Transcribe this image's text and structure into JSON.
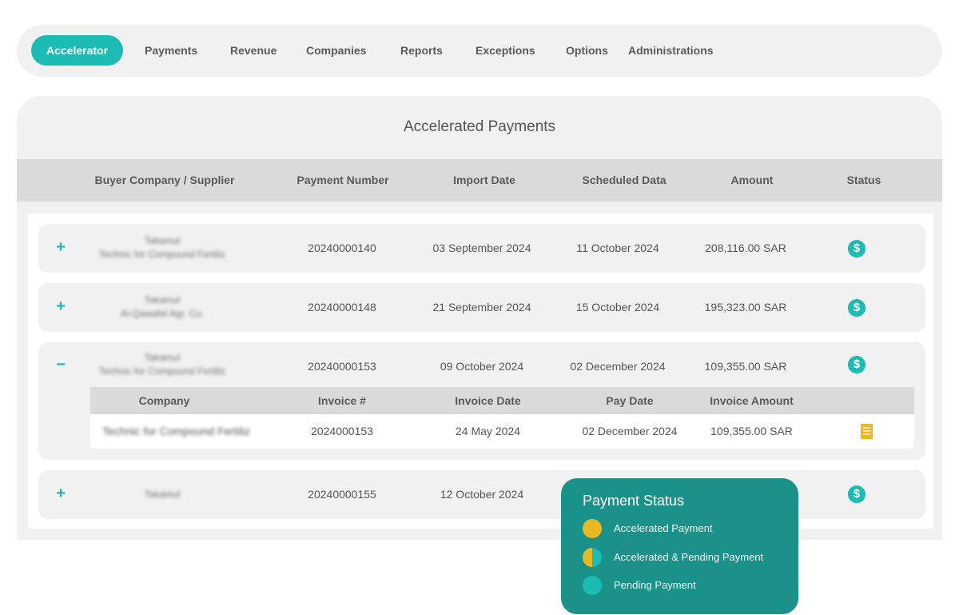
{
  "nav": {
    "items": [
      {
        "label": "Accelerator",
        "active": true
      },
      {
        "label": "Payments"
      },
      {
        "label": "Revenue"
      },
      {
        "label": "Companies"
      },
      {
        "label": "Reports"
      },
      {
        "label": "Exceptions"
      },
      {
        "label": "Options"
      },
      {
        "label": "Administrations"
      }
    ]
  },
  "panel": {
    "title": "Accelerated Payments",
    "columns": [
      "Buyer Company / Supplier",
      "Payment Number",
      "Import Date",
      "Scheduled Data",
      "Amount",
      "Status"
    ]
  },
  "rows": [
    {
      "toggle": "+",
      "buyer": "Takamul",
      "supplier": "Technic for Compound Fertiliz",
      "payment_number": "20240000140",
      "import_date": "03 September 2024",
      "scheduled_date": "11 October 2024",
      "amount": "208,116.00 SAR",
      "status_icon": "$"
    },
    {
      "toggle": "+",
      "buyer": "Takamul",
      "supplier": "Al-Qawafel Agr. Co.",
      "payment_number": "20240000148",
      "import_date": "21 September 2024",
      "scheduled_date": "15 October 2024",
      "amount": "195,323.00 SAR",
      "status_icon": "$"
    },
    {
      "toggle": "−",
      "buyer": "Takamul",
      "supplier": "Technic for Compound Fertiliz",
      "payment_number": "20240000153",
      "import_date": "09 October 2024",
      "scheduled_date": "02 December 2024",
      "amount": "109,355.00 SAR",
      "status_icon": "$",
      "invoices": {
        "columns": [
          "Company",
          "Invoice #",
          "Invoice Date",
          "Pay Date",
          "Invoice Amount"
        ],
        "items": [
          {
            "company": "Technic for Compound Fertiliz",
            "invoice_number": "2024000153",
            "invoice_date": "24 May 2024",
            "pay_date": "02 December 2024",
            "invoice_amount": "109,355.00 SAR"
          }
        ]
      }
    },
    {
      "toggle": "+",
      "buyer": "Takamul",
      "payment_number": "20240000155",
      "import_date": "12 October 2024",
      "status_icon": "$"
    }
  ],
  "legend": {
    "title": "Payment Status",
    "items": [
      {
        "label": "Accelerated Payment"
      },
      {
        "label": "Accelerated & Pending Payment"
      },
      {
        "label": "Pending Payment"
      }
    ]
  },
  "colors": {
    "accent": "#1cbcb4",
    "legend_bg": "#1a9189",
    "accelerated": "#e9b825",
    "pending": "#1cbcb4"
  }
}
